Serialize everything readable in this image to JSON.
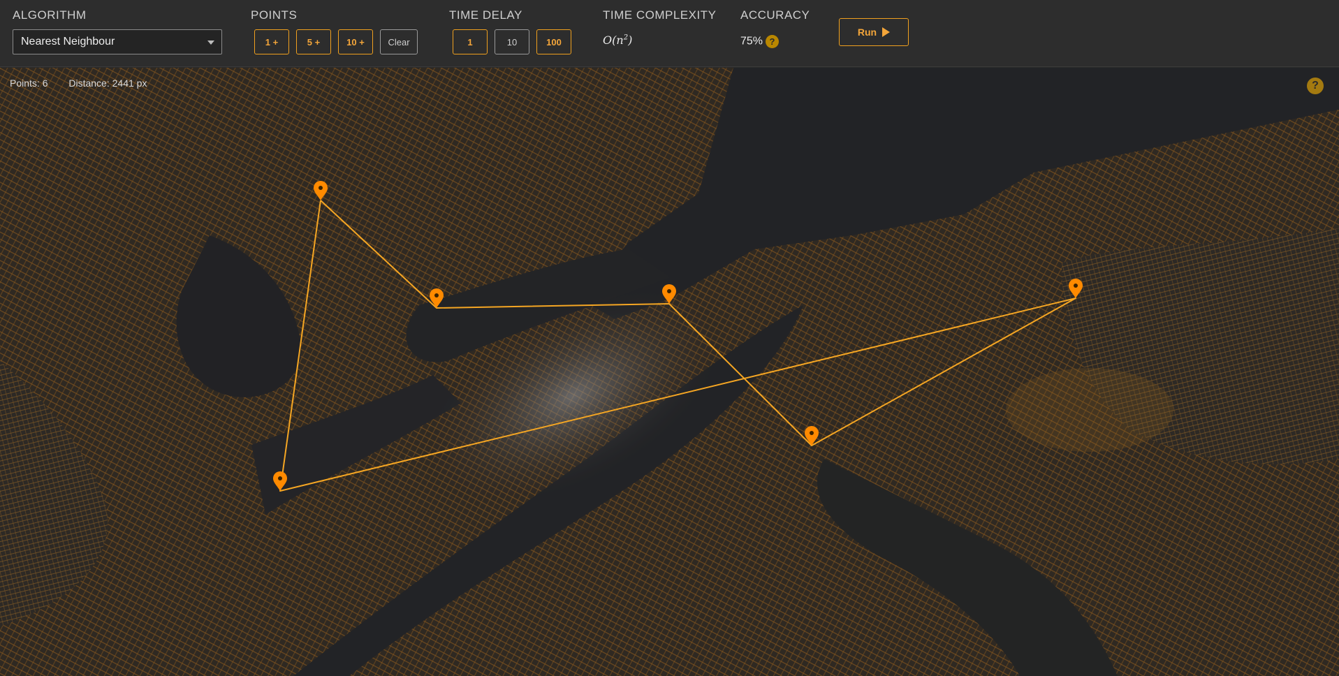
{
  "toolbar": {
    "algorithm": {
      "label": "ALGORITHM",
      "selected": "Nearest Neighbour"
    },
    "points": {
      "label": "POINTS",
      "buttons": [
        "1 +",
        "5 +",
        "10 +"
      ],
      "clear_label": "Clear"
    },
    "time_delay": {
      "label": "TIME DELAY",
      "options": [
        "1",
        "10",
        "100"
      ],
      "selected": "10"
    },
    "time_complexity": {
      "label": "TIME COMPLEXITY",
      "big_o": "O",
      "n": "n",
      "exp": "2"
    },
    "accuracy": {
      "label": "ACCURACY",
      "value": "75%",
      "help": "?"
    },
    "run_label": "Run"
  },
  "map": {
    "points_text": "Points: 6",
    "distance_text": "Distance: 2441 px",
    "help": "?",
    "accent_color": "#f5a623",
    "marker_color": "#ff8a00"
  }
}
